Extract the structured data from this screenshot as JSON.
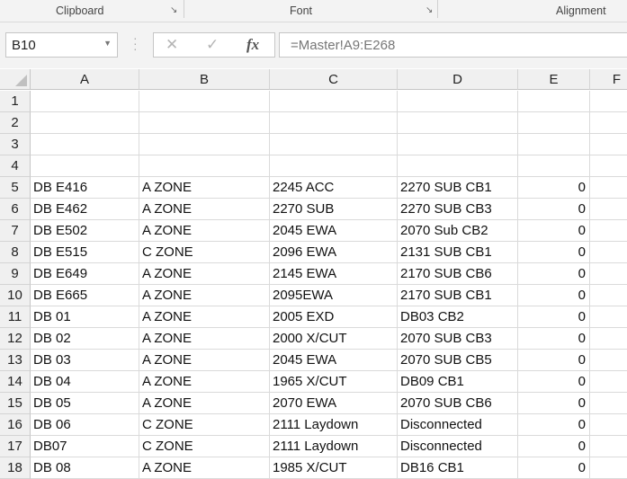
{
  "ribbon": {
    "groups": [
      "Clipboard",
      "Font",
      "Alignment"
    ]
  },
  "namebox": {
    "value": "B10"
  },
  "formula_bar": {
    "cancel": "✕",
    "enter": "✓",
    "fx": "fx",
    "value": "=Master!A9:E268"
  },
  "columns": [
    "A",
    "B",
    "C",
    "D",
    "E",
    "F"
  ],
  "rows": [
    {
      "n": "1",
      "cells": [
        "",
        "",
        "",
        "",
        ""
      ]
    },
    {
      "n": "2",
      "cells": [
        "",
        "",
        "",
        "",
        ""
      ]
    },
    {
      "n": "3",
      "cells": [
        "",
        "",
        "",
        "",
        ""
      ]
    },
    {
      "n": "4",
      "cells": [
        "",
        "",
        "",
        "",
        ""
      ]
    },
    {
      "n": "5",
      "cells": [
        "DB E416",
        "A ZONE",
        "2245 ACC",
        "2270 SUB CB1",
        "0"
      ]
    },
    {
      "n": "6",
      "cells": [
        "DB E462",
        "A ZONE",
        "2270 SUB",
        "2270 SUB CB3",
        "0"
      ]
    },
    {
      "n": "7",
      "cells": [
        "DB E502",
        "A ZONE",
        "2045 EWA",
        "2070 Sub CB2",
        "0"
      ]
    },
    {
      "n": "8",
      "cells": [
        "DB E515",
        "C ZONE",
        "2096 EWA",
        "2131 SUB CB1",
        "0"
      ]
    },
    {
      "n": "9",
      "cells": [
        "DB E649",
        "A ZONE",
        "2145 EWA",
        "2170 SUB CB6",
        "0"
      ]
    },
    {
      "n": "10",
      "cells": [
        "DB E665",
        "A ZONE",
        "2095EWA",
        "2170 SUB CB1",
        "0"
      ]
    },
    {
      "n": "11",
      "cells": [
        "DB 01",
        "A ZONE",
        "2005 EXD",
        "DB03 CB2",
        "0"
      ]
    },
    {
      "n": "12",
      "cells": [
        "DB 02",
        "A ZONE",
        "2000 X/CUT",
        "2070 SUB CB3",
        "0"
      ]
    },
    {
      "n": "13",
      "cells": [
        "DB 03",
        "A ZONE",
        "2045 EWA",
        "2070 SUB CB5",
        "0"
      ]
    },
    {
      "n": "14",
      "cells": [
        "DB 04",
        "A ZONE",
        "1965 X/CUT",
        "DB09 CB1",
        "0"
      ]
    },
    {
      "n": "15",
      "cells": [
        "DB 05",
        "A ZONE",
        "2070 EWA",
        "2070 SUB CB6",
        "0"
      ]
    },
    {
      "n": "16",
      "cells": [
        "DB 06",
        "C ZONE",
        "2111 Laydown",
        "Disconnected",
        "0"
      ]
    },
    {
      "n": "17",
      "cells": [
        "DB07",
        "C ZONE",
        "2111 Laydown",
        "Disconnected",
        "0"
      ]
    },
    {
      "n": "18",
      "cells": [
        "DB 08",
        "A ZONE",
        "1985 X/CUT",
        "DB16 CB1",
        "0"
      ]
    }
  ]
}
